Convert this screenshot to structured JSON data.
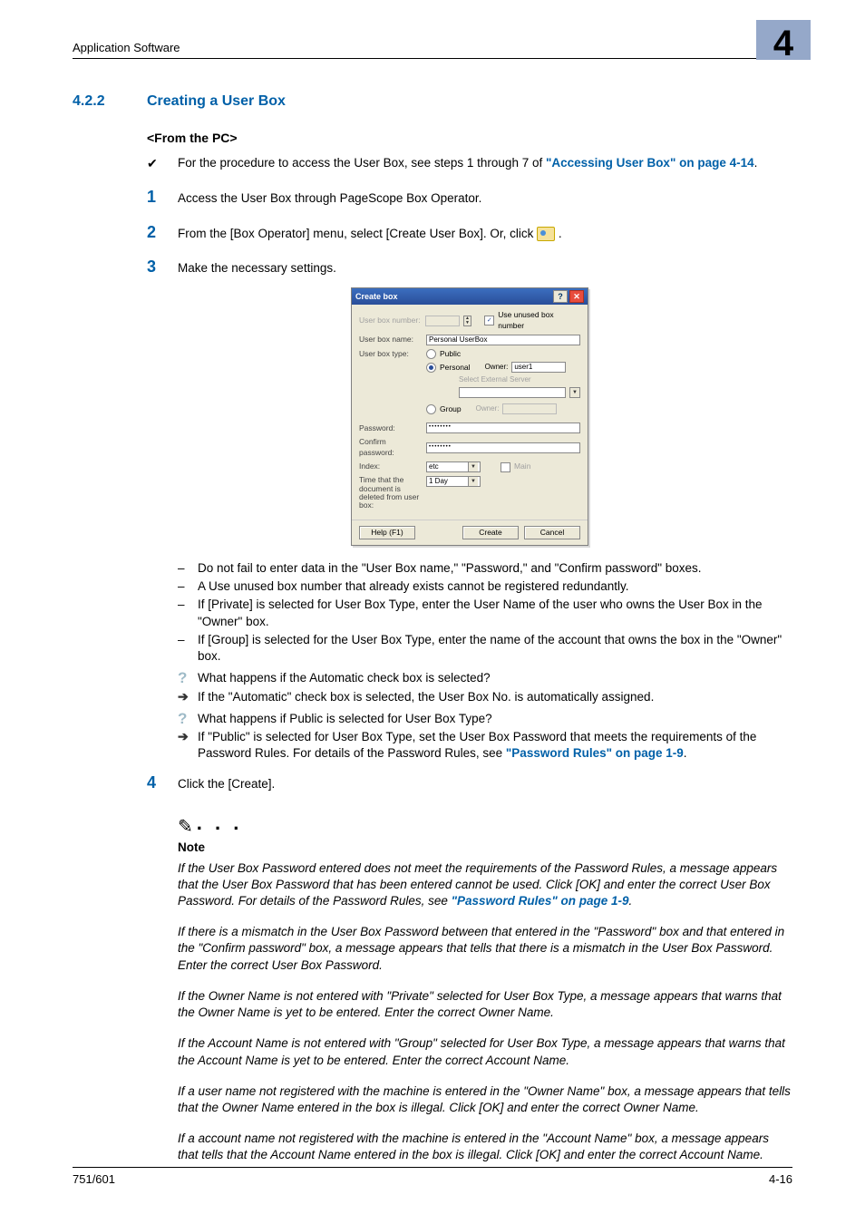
{
  "header": {
    "section_title": "Application Software",
    "chapter_mark": "4"
  },
  "section": {
    "number": "4.2.2",
    "title": "Creating a User Box",
    "subtitle": "<From the PC>"
  },
  "intro": {
    "text_a": "For the procedure to access the User Box, see steps 1 through 7 of ",
    "link": "\"Accessing User Box\" on page 4-14",
    "text_b": "."
  },
  "steps": {
    "s1": {
      "num": "1",
      "text": "Access the User Box through PageScope Box Operator."
    },
    "s2": {
      "num": "2",
      "text_a": "From the [Box Operator] menu, select [Create User Box]. Or, click ",
      "text_b": " ."
    },
    "s3": {
      "num": "3",
      "text": "Make the necessary settings."
    },
    "s4": {
      "num": "4",
      "text": "Click the [Create]."
    }
  },
  "dialog": {
    "title": "Create box",
    "lbl_box_no": "User box number:",
    "chk_unused": "Use unused box number",
    "lbl_box_name": "User box name:",
    "val_box_name": "Personal UserBox",
    "lbl_box_type": "User box type:",
    "radio_public": "Public",
    "radio_personal": "Personal",
    "owner_label": "Owner:",
    "owner_value": "user1",
    "ext_server": "Select External Server",
    "radio_group": "Group",
    "owner_dim": "Owner:",
    "lbl_password": "Password:",
    "val_password": "••••••••",
    "lbl_confirm": "Confirm password:",
    "val_confirm": "••••••••",
    "lbl_index": "Index:",
    "val_index": "etc",
    "chk_main": "Main",
    "lbl_time": "Time that the document is deleted from user box:",
    "val_time": "1 Day",
    "btn_help": "Help (F1)",
    "btn_create": "Create",
    "btn_cancel": "Cancel"
  },
  "bullets": {
    "b1": "Do not fail to enter data in the \"User Box name,\" \"Password,\" and \"Confirm password\" boxes.",
    "b2": "A Use unused box number that already exists cannot be registered redundantly.",
    "b3": "If [Private] is selected for User Box Type, enter the User Name of the user who owns the User Box in the \"Owner\" box.",
    "b4": "If [Group] is selected for the User Box Type, enter the name of the account that owns the box in the \"Owner\" box.",
    "q1": "What happens if the Automatic check box is selected?",
    "a1": "If the \"Automatic\" check box is selected, the User Box No. is automatically assigned.",
    "q2": "What happens if Public is selected for User Box Type?",
    "a2_a": "If \"Public\" is selected for User Box Type, set the User Box Password that meets the requirements of the Password Rules. For details of the Password Rules, see ",
    "a2_link": "\"Password Rules\" on page 1-9",
    "a2_b": "."
  },
  "note": {
    "dots": ". . .",
    "title": "Note",
    "p1_a": "If the User Box Password entered does not meet the requirements of the Password Rules, a message appears that the User Box Password that has been entered cannot be used. Click [OK] and enter the correct User Box Password. For details of the Password Rules, see ",
    "p1_link": "\"Password Rules\" on page 1-9",
    "p1_b": ".",
    "p2": "If there is a mismatch in the User Box Password between that entered in the \"Password\" box and that entered in the \"Confirm password\" box, a message appears that tells that there is a mismatch in the User Box Password. Enter the correct User Box Password.",
    "p3": "If the Owner Name is not entered with \"Private\" selected for User Box Type, a message appears that warns that the Owner Name is yet to be entered. Enter the correct Owner Name.",
    "p4": "If the Account Name is not entered with \"Group\" selected for User Box Type, a message appears that warns that the Account Name is yet to be entered. Enter the correct Account Name.",
    "p5": "If a user name not registered with the machine is entered in the \"Owner Name\" box, a message appears that tells that the Owner Name entered in the box is illegal. Click [OK] and enter the correct Owner Name.",
    "p6": "If a account name not registered with the machine is entered in the \"Account Name\" box, a message appears that tells that the Account Name entered in the box is illegal. Click [OK] and enter the correct Account Name."
  },
  "footer": {
    "left": "751/601",
    "right": "4-16"
  }
}
